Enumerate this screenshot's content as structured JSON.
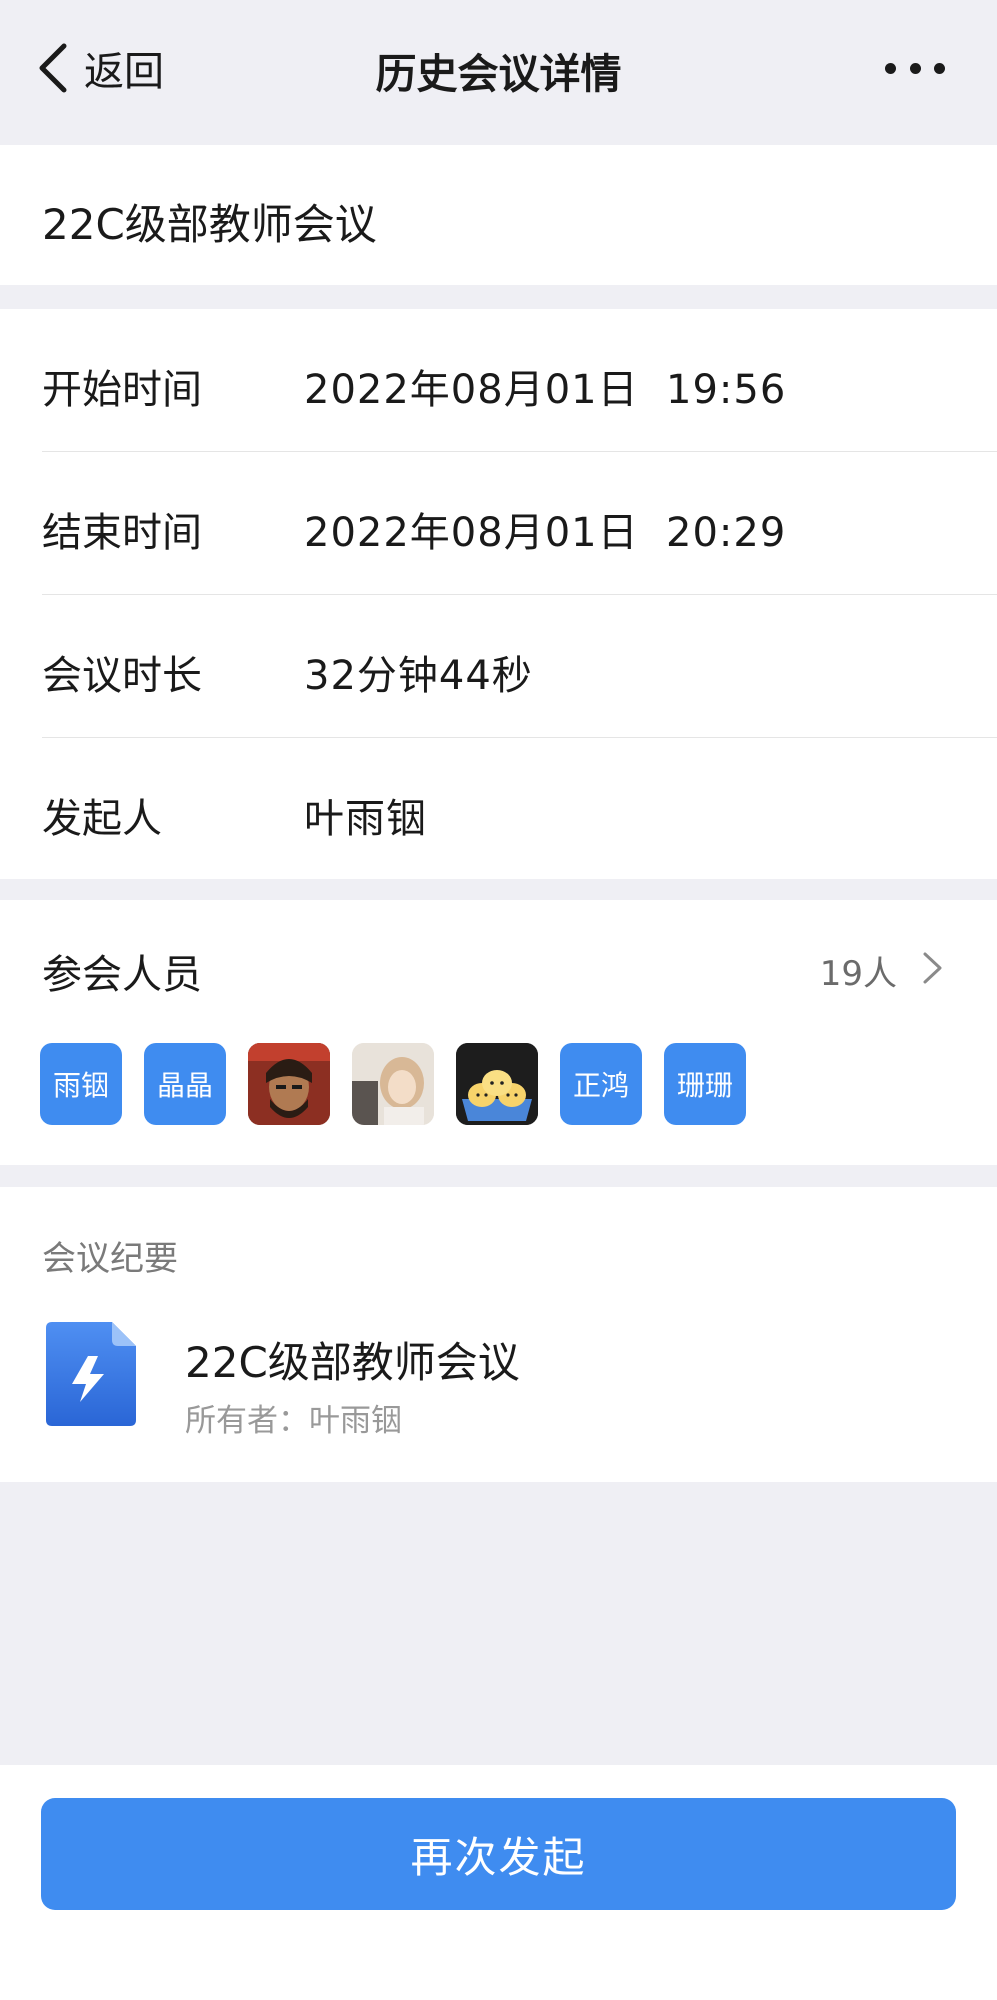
{
  "nav": {
    "back_label": "返回",
    "title": "历史会议详情",
    "more_icon": "more-dots-icon"
  },
  "meeting": {
    "name": "22C级部教师会议"
  },
  "details": [
    {
      "label": "开始时间",
      "value": "2022年08月01日  19:56"
    },
    {
      "label": "结束时间",
      "value": "2022年08月01日  20:29"
    },
    {
      "label": "会议时长",
      "value": "32分钟44秒"
    },
    {
      "label": "发起人",
      "value": "叶雨铟"
    }
  ],
  "participants": {
    "title": "参会人员",
    "count": "19人",
    "avatars": [
      {
        "type": "text",
        "text": "雨铟"
      },
      {
        "type": "text",
        "text": "晶晶"
      },
      {
        "type": "photo",
        "icon": "photo-avatar-man"
      },
      {
        "type": "photo",
        "icon": "photo-avatar-woman"
      },
      {
        "type": "photo",
        "icon": "cartoon-dumplings-avatar"
      },
      {
        "type": "text",
        "text": "正鸿"
      },
      {
        "type": "text",
        "text": "珊珊"
      }
    ]
  },
  "minutes": {
    "title": "会议纪要",
    "doc_name": "22C级部教师会议",
    "doc_owner": "所有者：叶雨铟",
    "doc_icon": "lightning-doc-icon"
  },
  "footer": {
    "button_label": "再次发起"
  },
  "colors": {
    "accent": "#3f8cf0",
    "background": "#efeff4"
  }
}
